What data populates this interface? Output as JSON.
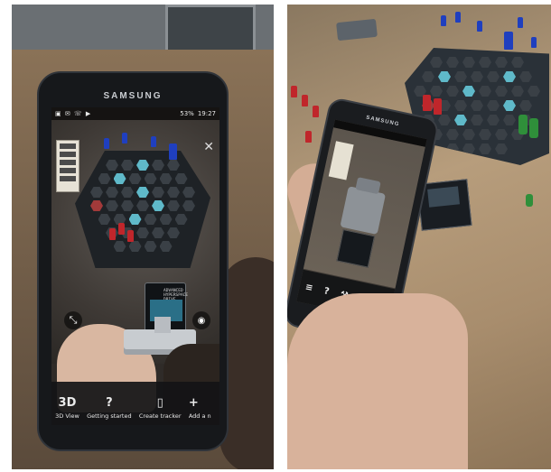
{
  "left_phone": {
    "brand": "SAMSUNG",
    "status_bar": {
      "left_icons": "▣ ✉ ☏ ▶",
      "battery": "53%",
      "time": "19:27"
    },
    "card_title": "ADVANCED HYPERSPACE DRIVE",
    "toolbar": {
      "items": [
        {
          "glyph": "3D",
          "label": "3D View"
        },
        {
          "glyph": "?",
          "label": "Getting started"
        },
        {
          "glyph": "▯",
          "label": "Create tracker"
        },
        {
          "glyph": "+",
          "label": "Add a n"
        }
      ]
    }
  },
  "right_phone": {
    "brand": "SAMSUNG",
    "toolbar_glyphs": [
      "≡",
      "?",
      "⚒",
      "⚒",
      "+"
    ]
  },
  "colors": {
    "ar_glow": "#5fb9c9",
    "player_red": "#c0262b",
    "player_blue": "#1f3fbf",
    "player_green": "#2f8f3a"
  }
}
